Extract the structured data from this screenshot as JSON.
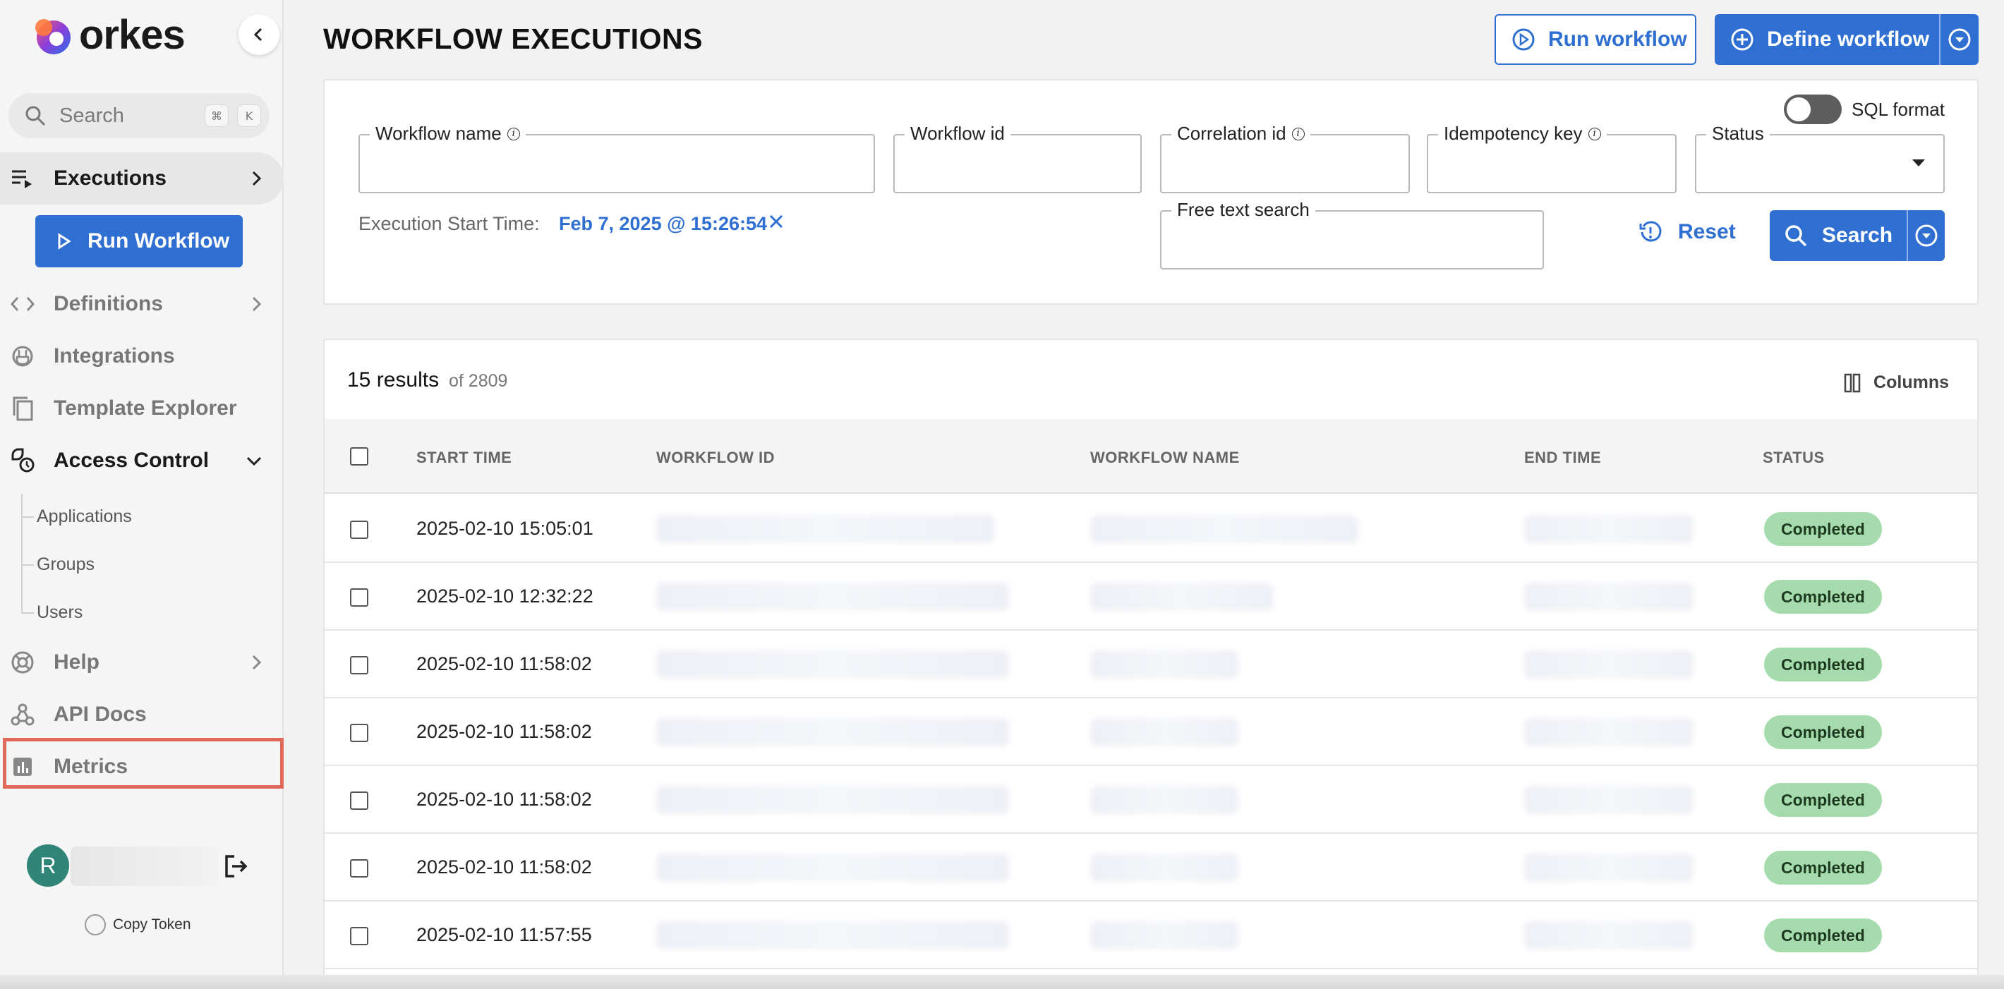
{
  "brand": {
    "name": "orkes"
  },
  "sidebar": {
    "search_label": "Search",
    "search_shortcut": [
      "⌘",
      "K"
    ],
    "executions_label": "Executions",
    "run_workflow_label": "Run Workflow",
    "definitions_label": "Definitions",
    "integrations_label": "Integrations",
    "template_explorer_label": "Template Explorer",
    "access_control_label": "Access Control",
    "access_control_items": [
      "Applications",
      "Groups",
      "Users"
    ],
    "help_label": "Help",
    "api_docs_label": "API Docs",
    "metrics_label": "Metrics",
    "user_initial": "R",
    "copy_token_label": "Copy Token"
  },
  "header": {
    "title": "WORKFLOW EXECUTIONS",
    "run_workflow_label": "Run workflow",
    "define_workflow_label": "Define workflow"
  },
  "filters": {
    "sql_format_label": "SQL format",
    "workflow_name_label": "Workflow name",
    "workflow_id_label": "Workflow id",
    "correlation_id_label": "Correlation id",
    "idempotency_key_label": "Idempotency key",
    "status_label": "Status",
    "free_text_label": "Free text search",
    "execution_start_label": "Execution Start Time:",
    "execution_start_value": "Feb 7, 2025 @ 15:26:54",
    "reset_label": "Reset",
    "search_label": "Search"
  },
  "results": {
    "count_label": "15 results",
    "of_label": "of 2809",
    "columns_label": "Columns",
    "headers": [
      "START TIME",
      "WORKFLOW ID",
      "WORKFLOW NAME",
      "END TIME",
      "STATUS"
    ],
    "rows": [
      {
        "start_time": "2025-02-10 15:05:01",
        "status": "Completed"
      },
      {
        "start_time": "2025-02-10 12:32:22",
        "status": "Completed"
      },
      {
        "start_time": "2025-02-10 11:58:02",
        "status": "Completed"
      },
      {
        "start_time": "2025-02-10 11:58:02",
        "status": "Completed"
      },
      {
        "start_time": "2025-02-10 11:58:02",
        "status": "Completed"
      },
      {
        "start_time": "2025-02-10 11:58:02",
        "status": "Completed"
      },
      {
        "start_time": "2025-02-10 11:57:55",
        "status": "Completed"
      }
    ]
  },
  "colors": {
    "accent": "#2f6fd2",
    "completed_badge": "#a6dbad",
    "highlight": "#e06a5a"
  }
}
